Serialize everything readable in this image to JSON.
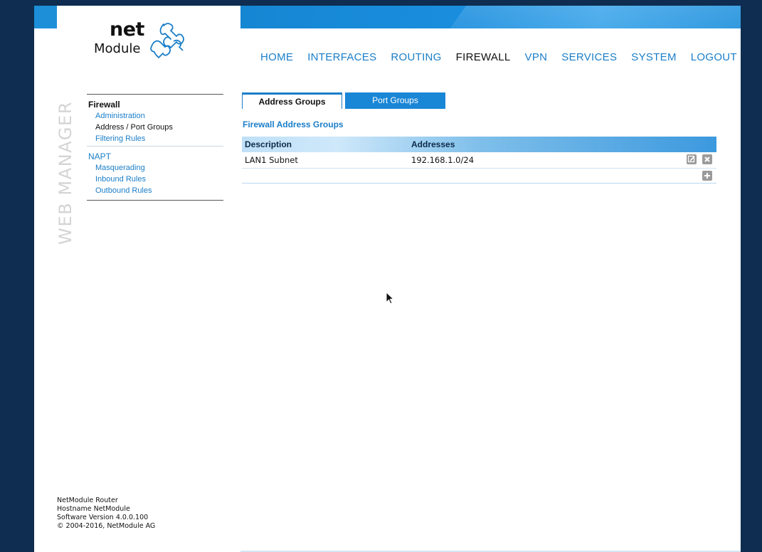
{
  "brand": {
    "logo_word_top": "net",
    "logo_word_bottom": "Module",
    "side_title": "WEB MANAGER",
    "accent": "#1a7ec8",
    "header_blue": "#1a8ede",
    "frame_background": "#0e2d50"
  },
  "topnav": {
    "items": [
      {
        "label": "HOME"
      },
      {
        "label": "INTERFACES"
      },
      {
        "label": "ROUTING"
      },
      {
        "label": "FIREWALL"
      },
      {
        "label": "VPN"
      },
      {
        "label": "SERVICES"
      },
      {
        "label": "SYSTEM"
      },
      {
        "label": "LOGOUT"
      }
    ],
    "active": "FIREWALL"
  },
  "sidebar": {
    "sections": [
      {
        "title": "Firewall",
        "items": [
          {
            "label": "Administration"
          },
          {
            "label": "Address / Port Groups"
          },
          {
            "label": "Filtering Rules"
          }
        ]
      },
      {
        "title": "NAPT",
        "items": [
          {
            "label": "Masquerading"
          },
          {
            "label": "Inbound Rules"
          },
          {
            "label": "Outbound Rules"
          }
        ]
      }
    ],
    "active_item": "Address / Port Groups"
  },
  "footer": {
    "product": "NetModule Router",
    "hostname": "Hostname NetModule",
    "software": "Software Version 4.0.0.100",
    "copyright": "© 2004-2016, NetModule AG"
  },
  "main": {
    "tabs": [
      {
        "label": "Address Groups"
      },
      {
        "label": "Port Groups"
      }
    ],
    "active_tab": "Address Groups",
    "heading": "Firewall Address Groups",
    "table": {
      "columns": [
        "Description",
        "Addresses"
      ],
      "rows": [
        {
          "description": "LAN1 Subnet",
          "addresses": "192.168.1.0/24"
        }
      ]
    },
    "icons": {
      "edit": "edit-icon",
      "delete": "delete-icon",
      "add": "add-icon"
    }
  }
}
